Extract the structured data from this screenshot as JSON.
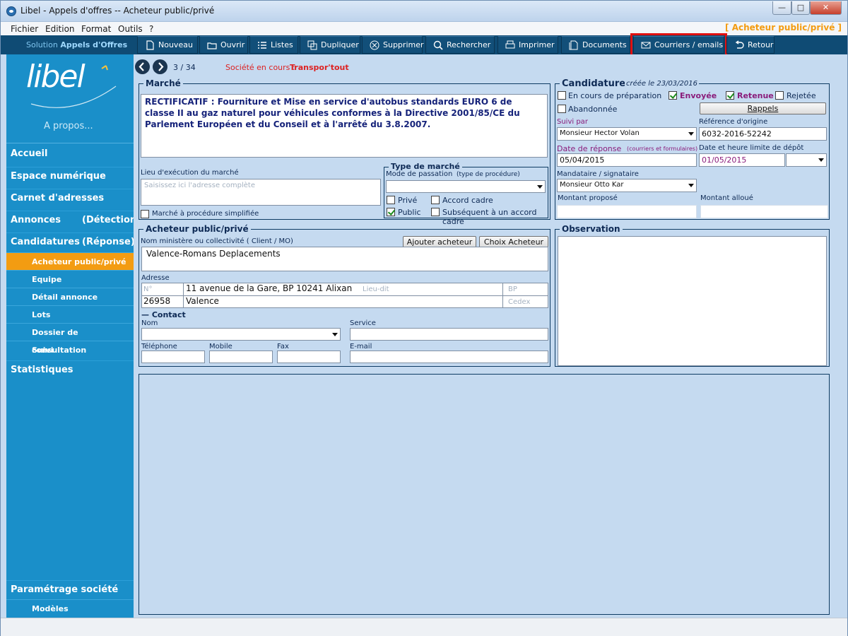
{
  "window": {
    "title": "Libel - Appels d'offres -- Acheteur public/privé"
  },
  "menu": [
    "Fichier",
    "Edition",
    "Format",
    "Outils",
    "?"
  ],
  "breadcrumb": "[ Acheteur public/privé ]",
  "toolbar": {
    "solution_prefix": "Solution",
    "solution_name": "Appels d'Offres",
    "buttons": [
      "Nouveau",
      "Ouvrir",
      "Listes",
      "Dupliquer",
      "Supprimer",
      "Rechercher",
      "Imprimer",
      "Documents",
      "Courriers / emails",
      "Retour"
    ],
    "highlighted": "Courriers / emails"
  },
  "sidebar": {
    "logo_text": "libel",
    "about": "A propos...",
    "items": [
      {
        "label": "Accueil"
      },
      {
        "label": "Espace numérique"
      },
      {
        "label": "Carnet d'adresses"
      },
      {
        "label": "Annonces",
        "extra": "(Détection)"
      },
      {
        "label": "Candidatures",
        "extra": "(Réponse)"
      }
    ],
    "subitems": [
      "Acheteur public/privé",
      "Equipe",
      "Détail annonce",
      "Lots",
      "Dossier de consultation",
      "Suivi"
    ],
    "active_sub": "Acheteur public/privé",
    "stats": "Statistiques",
    "settings": "Paramétrage société",
    "settings_sub": "Modèles"
  },
  "nav": {
    "position": "3 / 34",
    "company_label": "Société en cours :",
    "company": "Transpor'tout"
  },
  "marche": {
    "title": "Marché",
    "description": "RECTIFICATIF : Fourniture et Mise en service d'autobus standards EURO 6 de classe II au gaz naturel pour véhicules conformes à la Directive 2001/85/CE du Parlement Européen et du Conseil et à l'arrêté du 3.8.2007.",
    "lieu_label": "Lieu d'exécution du marché",
    "lieu_placeholder": "Saisissez ici l'adresse complète",
    "simplifiee_label": "Marché à procédure simplifiée",
    "type_title": "Type de marché",
    "mode_label": "Mode de passation",
    "mode_hint": "(type de procédure)",
    "prive": "Privé",
    "public": "Public",
    "accord_cadre": "Accord cadre",
    "subsequent": "Subséquent à un accord cadre"
  },
  "candidature": {
    "title": "Candidature",
    "created": "créée le 23/03/2016",
    "en_cours": "En cours de préparation",
    "envoyee": "Envoyée",
    "retenue": "Retenue",
    "rejetee": "Rejetée",
    "abandonnee": "Abandonnée",
    "rappels": "Rappels",
    "suivi_label": "Suivi par",
    "suivi_value": "Monsieur Hector Volan",
    "ref_label": "Référence d'origine",
    "ref_value": "6032-2016-52242",
    "date_rep_label": "Date de réponse",
    "date_rep_hint": "(courriers et formulaires)",
    "date_rep_value": "05/04/2015",
    "date_lim_label": "Date et heure limite de dépôt",
    "date_lim_value": "01/05/2015",
    "mandataire_label": "Mandataire / signataire",
    "mandataire_value": "Monsieur Otto Kar",
    "montant_prop_label": "Montant proposé",
    "montant_alloue_label": "Montant alloué"
  },
  "acheteur": {
    "title": "Acheteur public/privé",
    "nom_label": "Nom ministère ou collectivité ( Client / MO)",
    "add_btn": "Ajouter acheteur",
    "choice_btn": "Choix Acheteur",
    "nom_value": "Valence-Romans Deplacements",
    "adresse_label": "Adresse",
    "num_ph": "N°",
    "street_value": "11 avenue de la Gare, BP 10241 Alixan",
    "lieudit_ph": "Lieu-dit",
    "bp_ph": "BP",
    "cp_value": "26958",
    "city_value": "Valence",
    "cedex_ph": "Cedex",
    "contact_title": "— Contact",
    "nom2_label": "Nom",
    "service_label": "Service",
    "tel_label": "Téléphone",
    "mobile_label": "Mobile",
    "fax_label": "Fax",
    "email_label": "E-mail"
  },
  "observation": {
    "title": "Observation"
  }
}
